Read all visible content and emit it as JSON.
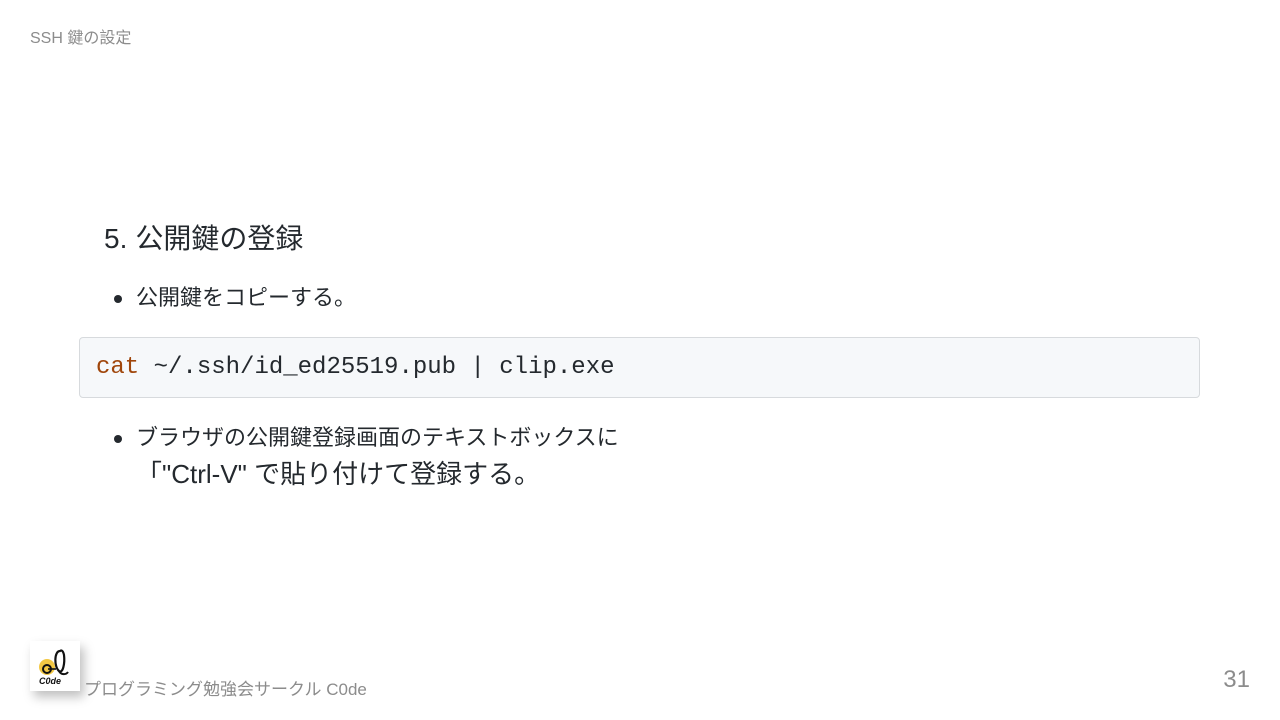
{
  "header": {
    "title": "SSH 鍵の設定"
  },
  "step": {
    "number": "5.",
    "title": "公開鍵の登録"
  },
  "bullets": [
    {
      "text": "公開鍵をコピーする。"
    },
    {
      "line1": "ブラウザの公開鍵登録画面のテキストボックスに",
      "line2": "「\"Ctrl-V\" で貼り付けて登録する。"
    }
  ],
  "code": {
    "command": "cat",
    "args": " ~/.ssh/id_ed25519.pub | clip.exe"
  },
  "footer": {
    "logo_text": "C0de",
    "organization": "プログラミング勉強会サークル C0de",
    "page_number": "31"
  },
  "colors": {
    "code_keyword": "#a0460b",
    "code_background": "#f6f8fa",
    "muted_text": "#8c8c8c"
  }
}
